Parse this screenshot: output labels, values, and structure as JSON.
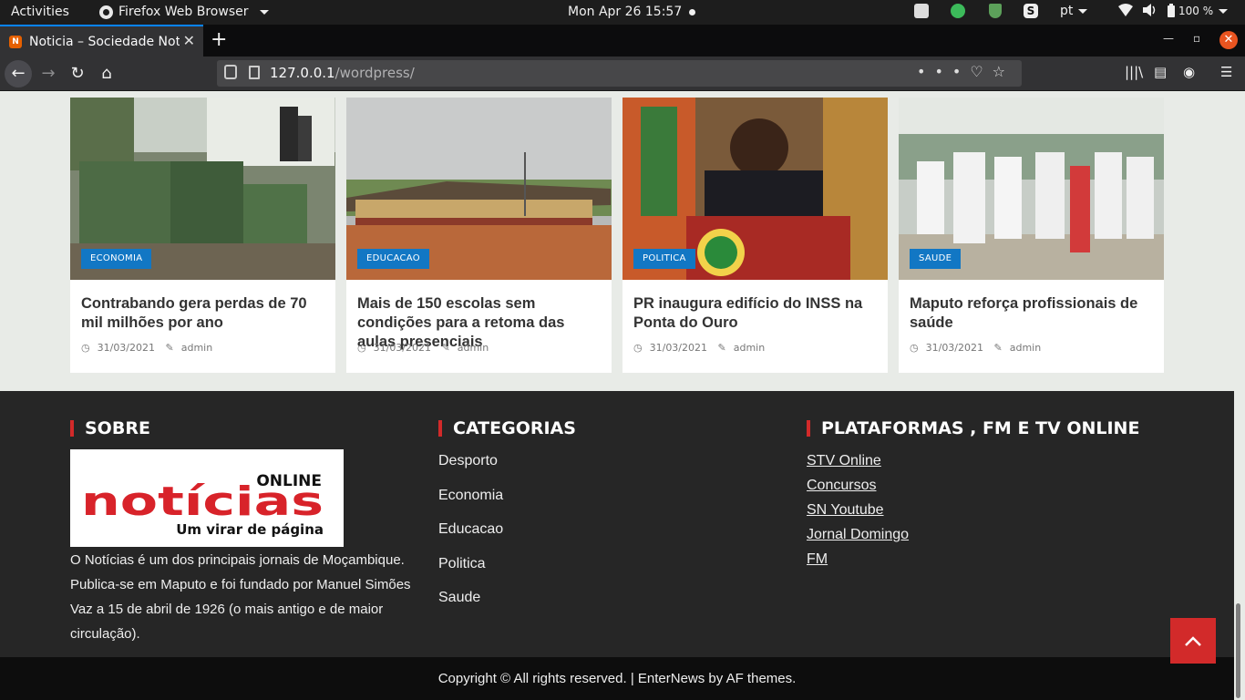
{
  "system": {
    "activities": "Activities",
    "app_name": "Firefox Web Browser",
    "clock": "Mon Apr 26  15:57",
    "lang": "pt",
    "battery": "100 %"
  },
  "browser": {
    "tab_title": "Noticia – Sociedade Notícias",
    "url_host": "127.0.0.1",
    "url_path": "/wordpress/"
  },
  "articles": [
    {
      "category": "ECONOMIA",
      "title": "Contrabando gera perdas de 70 mil milhões por ano",
      "date": "31/03/2021",
      "author": "admin"
    },
    {
      "category": "EDUCACAO",
      "title": "Mais de 150 escolas sem condições para a retoma das aulas presenciais",
      "date": "31/03/2021",
      "author": "admin"
    },
    {
      "category": "POLITICA",
      "title": "PR inaugura edifício do INSS na Ponta do Ouro",
      "date": "31/03/2021",
      "author": "admin"
    },
    {
      "category": "SAUDE",
      "title": "Maputo reforça profissionais de saúde",
      "date": "31/03/2021",
      "author": "admin"
    }
  ],
  "footer": {
    "sobre_title": "SOBRE",
    "logo_online": "ONLINE",
    "logo_main": "notícias",
    "logo_tagline": "Um virar de página",
    "about_text": "O Notícias é um dos principais jornais de Moçambique. Publica-se em Maputo e foi fundado por Manuel Simões Vaz a 15 de abril de 1926 (o mais antigo e de maior circulação).",
    "categorias_title": "CATEGORIAS",
    "categorias": [
      "Desporto",
      "Economia",
      "Educacao",
      "Politica",
      "Saude"
    ],
    "plataformas_title": "PLATAFORMAS , FM E TV ONLINE",
    "plataformas": [
      "STV Online",
      "Concursos",
      "SN Youtube",
      "Jornal Domingo",
      "FM"
    ],
    "copyright": "Copyright © All rights reserved. | EnterNews by AF themes."
  },
  "colors": {
    "accent_red": "#d22a2a",
    "badge_blue": "#1277c4",
    "footer_bg": "#262626"
  },
  "icons": [
    "firefox-icon",
    "back-icon",
    "forward-icon",
    "reload-icon",
    "home-icon",
    "bookmark-star-icon",
    "pocket-icon",
    "library-icon",
    "sidebar-icon",
    "account-icon",
    "menu-icon",
    "clock-icon",
    "edit-icon",
    "chevron-up-icon"
  ]
}
